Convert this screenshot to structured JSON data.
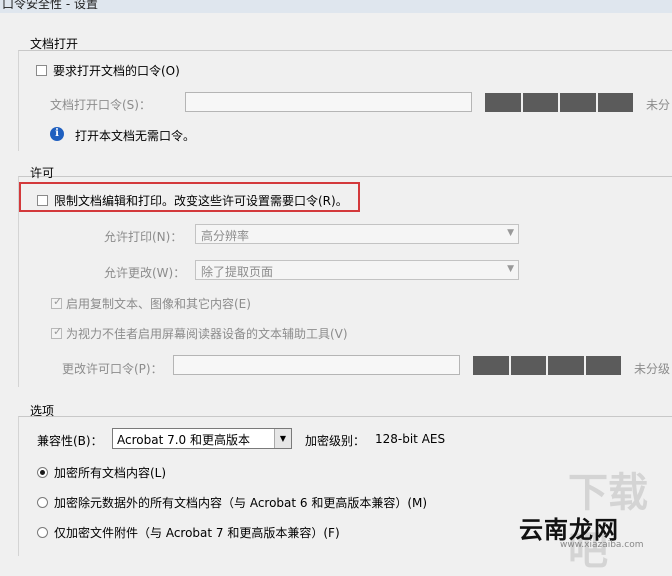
{
  "window": {
    "title": "口令安全性 - 设置"
  },
  "document_open": {
    "section_title": "文档打开",
    "require_password_label": "要求打开文档的口令(O)",
    "password_field_label": "文档打开口令(S)：",
    "strength_label": "未分",
    "info_text": "打开本文档无需口令。"
  },
  "permissions": {
    "section_title": "许可",
    "restrict_label": "限制文档编辑和打印。改变这些许可设置需要口令(R)。",
    "printing_label": "允许打印(N)：",
    "printing_value": "高分辨率",
    "changes_label": "允许更改(W)：",
    "changes_value": "除了提取页面",
    "enable_copy_label": "启用复制文本、图像和其它内容(E)",
    "enable_screen_reader_label": "为视力不佳者启用屏幕阅读器设备的文本辅助工具(V)",
    "change_password_label": "更改许可口令(P)：",
    "strength_label": "未分级"
  },
  "options": {
    "section_title": "选项",
    "compat_label": "兼容性(B)：",
    "compat_value": "Acrobat 7.0 和更高版本",
    "encryption_label": "加密级别：",
    "encryption_value": "128-bit AES",
    "radio_all": "加密所有文档内容(L)",
    "radio_except_metadata": "加密除元数据外的所有文档内容（与 Acrobat 6 和更高版本兼容）(M)",
    "radio_attachments": "仅加密文件附件（与 Acrobat 7 和更高版本兼容）(F)"
  },
  "watermark": {
    "brand": "云南龙网",
    "url": "www.xiazaiba.com",
    "faint": "下载吧"
  }
}
